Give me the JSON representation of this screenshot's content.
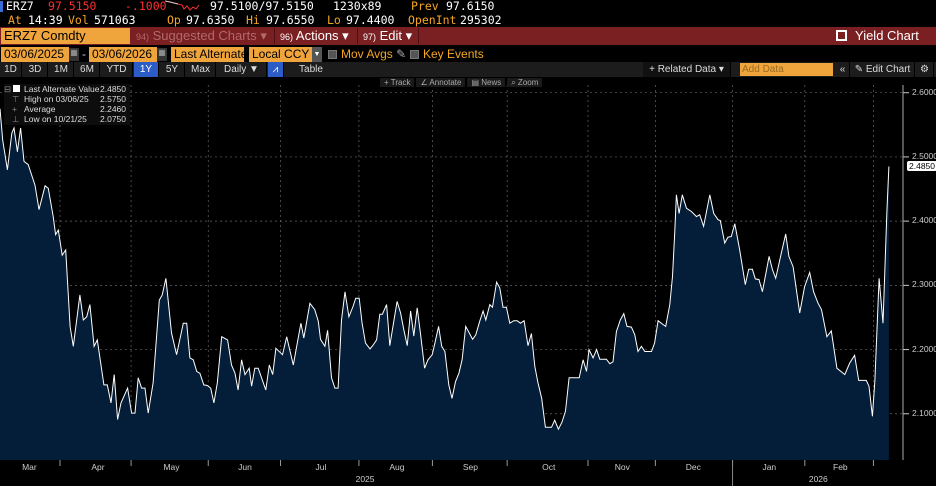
{
  "quote": {
    "ticker": "ERZ7",
    "last": "97.5150",
    "change": "-.1000",
    "bid_ask": "97.5100/97.5150",
    "size": "1230x89",
    "prev_label": "Prev",
    "prev": "97.6150",
    "at_label": "At",
    "time": "14:39",
    "vol_label": "Vol",
    "vol": "571063",
    "op_label": "Op",
    "op": "97.6350",
    "hi_label": "Hi",
    "hi": "97.6550",
    "lo_label": "Lo",
    "lo": "97.4400",
    "oi_label": "OpenInt",
    "oi": "295302"
  },
  "menubar": {
    "security": "ERZ7 Comdty",
    "suggested_num": "94)",
    "suggested": "Suggested Charts ▾",
    "actions_num": "96)",
    "actions": "Actions ▾",
    "edit_num": "97)",
    "edit": "Edit ▾",
    "yield_chart": "Yield Chart"
  },
  "controls": {
    "start_date": "03/06/2025",
    "end_date": "03/06/2026",
    "dash": "-",
    "field": "Last Alternate",
    "currency": "Local CCY",
    "mov_avgs": "Mov Avgs",
    "key_events": "Key Events"
  },
  "periods": [
    "1D",
    "3D",
    "1M",
    "6M",
    "YTD",
    "1Y",
    "5Y",
    "Max"
  ],
  "selected_period": "1Y",
  "frequency": "Daily ▼",
  "table_label": "Table",
  "right_toolbar": {
    "related": "+ Related Data ▾",
    "add_data_placeholder": "Add Data",
    "collapse": "«",
    "edit_chart": "✎ Edit Chart",
    "gear": "⚙"
  },
  "chart_tools": [
    "+ Track",
    "∠ Annotate",
    "▤ News",
    "⌕ Zoom"
  ],
  "legend": [
    {
      "label": "Last Alternate Value",
      "value": "2.4850"
    },
    {
      "label": "High on 03/06/25",
      "value": "2.5750"
    },
    {
      "label": "Average",
      "value": "2.2460"
    },
    {
      "label": "Low on 10/21/25",
      "value": "2.0750"
    }
  ],
  "colors": {
    "area": "#041d38",
    "line": "#ffffff",
    "accent": "#f0a53c",
    "menubar": "#7a1f22"
  },
  "chart_data": {
    "type": "area",
    "title": "ERZ7 Comdty Last Alternate Value",
    "x_unit": "days since 03/06/2025",
    "ylim": [
      2.028,
      2.612
    ],
    "y_ticks": [
      "2.6000",
      "2.5000",
      "2.4000",
      "2.3000",
      "2.2000",
      "2.1000"
    ],
    "y_tick_values": [
      2.6,
      2.5,
      2.4,
      2.3,
      2.2,
      2.1
    ],
    "last_value_label": "2.4850",
    "last_value": 2.485,
    "month_ticks": [
      {
        "label": "Mar",
        "mid": 12
      },
      {
        "label": "Apr",
        "mid": 40
      },
      {
        "label": "May",
        "mid": 70
      },
      {
        "label": "Jun",
        "mid": 100
      },
      {
        "label": "Jul",
        "mid": 131
      },
      {
        "label": "Aug",
        "mid": 162
      },
      {
        "label": "Sep",
        "mid": 192
      },
      {
        "label": "Oct",
        "mid": 224
      },
      {
        "label": "Nov",
        "mid": 254
      },
      {
        "label": "Dec",
        "mid": 283
      },
      {
        "label": "Jan",
        "mid": 314
      },
      {
        "label": "Feb",
        "mid": 343
      }
    ],
    "month_boundaries": [
      24.5,
      53.5,
      85,
      114.5,
      146.5,
      176.5,
      207,
      240,
      267.5,
      299,
      328.5,
      356.5
    ],
    "years": [
      {
        "label": "2025",
        "mid": 149
      },
      {
        "label": "2026",
        "mid": 334
      }
    ],
    "points": [
      [
        0,
        2.575
      ],
      [
        1.1,
        2.526
      ],
      [
        3,
        2.48
      ],
      [
        4.8,
        2.537
      ],
      [
        5.7,
        2.545
      ],
      [
        7.1,
        2.508
      ],
      [
        8.4,
        2.545
      ],
      [
        9.8,
        2.493
      ],
      [
        11.5,
        2.488
      ],
      [
        14.3,
        2.456
      ],
      [
        15.9,
        2.418
      ],
      [
        18.4,
        2.455
      ],
      [
        19.7,
        2.451
      ],
      [
        21.7,
        2.407
      ],
      [
        22.7,
        2.379
      ],
      [
        23.8,
        2.386
      ],
      [
        25.4,
        2.347
      ],
      [
        26.8,
        2.355
      ],
      [
        28.6,
        2.236
      ],
      [
        29.9,
        2.205
      ],
      [
        32.6,
        2.285
      ],
      [
        34,
        2.246
      ],
      [
        35.4,
        2.251
      ],
      [
        36.7,
        2.27
      ],
      [
        38.4,
        2.205
      ],
      [
        39.7,
        2.215
      ],
      [
        42.4,
        2.145
      ],
      [
        43.8,
        2.145
      ],
      [
        45.3,
        2.117
      ],
      [
        46.6,
        2.161
      ],
      [
        48,
        2.091
      ],
      [
        49.4,
        2.117
      ],
      [
        52.1,
        2.14
      ],
      [
        53.7,
        2.101
      ],
      [
        55.1,
        2.101
      ],
      [
        56.4,
        2.156
      ],
      [
        57.8,
        2.14
      ],
      [
        59.2,
        2.14
      ],
      [
        60.5,
        2.101
      ],
      [
        62.5,
        2.148
      ],
      [
        65,
        2.277
      ],
      [
        66.2,
        2.285
      ],
      [
        67.7,
        2.311
      ],
      [
        70,
        2.226
      ],
      [
        72.1,
        2.192
      ],
      [
        74.8,
        2.241
      ],
      [
        76.2,
        2.241
      ],
      [
        77.5,
        2.187
      ],
      [
        78.9,
        2.184
      ],
      [
        80.3,
        2.166
      ],
      [
        81.6,
        2.163
      ],
      [
        83.2,
        2.145
      ],
      [
        84.6,
        2.144
      ],
      [
        86,
        2.14
      ],
      [
        87.3,
        2.117
      ],
      [
        88.7,
        2.148
      ],
      [
        90.5,
        2.22
      ],
      [
        92.9,
        2.215
      ],
      [
        94.5,
        2.176
      ],
      [
        95.9,
        2.163
      ],
      [
        97.2,
        2.137
      ],
      [
        98.6,
        2.184
      ],
      [
        100,
        2.161
      ],
      [
        101.7,
        2.171
      ],
      [
        102.7,
        2.143
      ],
      [
        104,
        2.171
      ],
      [
        105.4,
        2.171
      ],
      [
        108.5,
        2.137
      ],
      [
        109.9,
        2.176
      ],
      [
        111.3,
        2.161
      ],
      [
        112.6,
        2.202
      ],
      [
        115.3,
        2.192
      ],
      [
        117,
        2.22
      ],
      [
        119.7,
        2.176
      ],
      [
        122.8,
        2.241
      ],
      [
        124,
        2.218
      ],
      [
        126.5,
        2.272
      ],
      [
        128.5,
        2.262
      ],
      [
        129.9,
        2.244
      ],
      [
        130.8,
        2.216
      ],
      [
        132.6,
        2.205
      ],
      [
        133.7,
        2.23
      ],
      [
        135.3,
        2.156
      ],
      [
        136.7,
        2.14
      ],
      [
        138,
        2.14
      ],
      [
        139.4,
        2.246
      ],
      [
        140.8,
        2.29
      ],
      [
        142.4,
        2.251
      ],
      [
        144.1,
        2.267
      ],
      [
        145.2,
        2.28
      ],
      [
        146.6,
        2.28
      ],
      [
        147.8,
        2.241
      ],
      [
        149.2,
        2.21
      ],
      [
        151,
        2.201
      ],
      [
        152.3,
        2.207
      ],
      [
        153.7,
        2.215
      ],
      [
        155,
        2.255
      ],
      [
        156.1,
        2.255
      ],
      [
        157.8,
        2.27
      ],
      [
        159.1,
        2.206
      ],
      [
        160.8,
        2.246
      ],
      [
        162.1,
        2.275
      ],
      [
        163.5,
        2.257
      ],
      [
        164.8,
        2.231
      ],
      [
        166.2,
        2.206
      ],
      [
        167.6,
        2.26
      ],
      [
        168.9,
        2.221
      ],
      [
        170.3,
        2.265
      ],
      [
        171.6,
        2.226
      ],
      [
        173.3,
        2.171
      ],
      [
        174.7,
        2.184
      ],
      [
        176.4,
        2.192
      ],
      [
        177.5,
        2.21
      ],
      [
        179,
        2.236
      ],
      [
        180.3,
        2.205
      ],
      [
        181.6,
        2.197
      ],
      [
        183.2,
        2.145
      ],
      [
        184.5,
        2.124
      ],
      [
        185.9,
        2.15
      ],
      [
        187.3,
        2.163
      ],
      [
        188.6,
        2.184
      ],
      [
        190.1,
        2.236
      ],
      [
        191.5,
        2.226
      ],
      [
        192.9,
        2.216
      ],
      [
        194.2,
        2.223
      ],
      [
        195.8,
        2.244
      ],
      [
        197.2,
        2.26
      ],
      [
        198.3,
        2.246
      ],
      [
        199.9,
        2.27
      ],
      [
        201,
        2.266
      ],
      [
        202.7,
        2.305
      ],
      [
        204,
        2.296
      ],
      [
        205.3,
        2.266
      ],
      [
        206.7,
        2.266
      ],
      [
        208.1,
        2.241
      ],
      [
        209.7,
        2.245
      ],
      [
        211.1,
        2.245
      ],
      [
        212.4,
        2.241
      ],
      [
        213.9,
        2.245
      ],
      [
        215.5,
        2.206
      ],
      [
        216.9,
        2.225
      ],
      [
        218.3,
        2.174
      ],
      [
        219.6,
        2.148
      ],
      [
        221.1,
        2.124
      ],
      [
        222.6,
        2.079
      ],
      [
        225.1,
        2.079
      ],
      [
        226.4,
        2.09
      ],
      [
        227.9,
        2.076
      ],
      [
        229.4,
        2.087
      ],
      [
        230.8,
        2.104
      ],
      [
        232.3,
        2.156
      ],
      [
        236.4,
        2.156
      ],
      [
        238,
        2.184
      ],
      [
        239.4,
        2.166
      ],
      [
        240.4,
        2.2
      ],
      [
        242.1,
        2.187
      ],
      [
        243.5,
        2.2
      ],
      [
        244.8,
        2.185
      ],
      [
        247.5,
        2.185
      ],
      [
        248.9,
        2.178
      ],
      [
        250.2,
        2.181
      ],
      [
        251.6,
        2.228
      ],
      [
        253.2,
        2.246
      ],
      [
        254.6,
        2.256
      ],
      [
        255.9,
        2.236
      ],
      [
        257.7,
        2.235
      ],
      [
        259.1,
        2.223
      ],
      [
        260.4,
        2.197
      ],
      [
        261.8,
        2.205
      ],
      [
        263.2,
        2.197
      ],
      [
        265.9,
        2.197
      ],
      [
        267.2,
        2.21
      ],
      [
        268.6,
        2.245
      ],
      [
        270.6,
        2.239
      ],
      [
        271.7,
        2.236
      ],
      [
        273.4,
        2.27
      ],
      [
        274.5,
        2.314
      ],
      [
        275.4,
        2.381
      ],
      [
        276.1,
        2.441
      ],
      [
        277.2,
        2.412
      ],
      [
        278.5,
        2.441
      ],
      [
        280.2,
        2.42
      ],
      [
        282.2,
        2.415
      ],
      [
        284.3,
        2.407
      ],
      [
        285.6,
        2.41
      ],
      [
        287.2,
        2.392
      ],
      [
        289.7,
        2.441
      ],
      [
        291.3,
        2.412
      ],
      [
        293.1,
        2.402
      ],
      [
        294,
        2.401
      ],
      [
        295.8,
        2.366
      ],
      [
        297.1,
        2.375
      ],
      [
        298.5,
        2.376
      ],
      [
        299.9,
        2.396
      ],
      [
        301.9,
        2.355
      ],
      [
        304.2,
        2.301
      ],
      [
        305.6,
        2.325
      ],
      [
        307.1,
        2.325
      ],
      [
        308.3,
        2.31
      ],
      [
        309.8,
        2.309
      ],
      [
        311.2,
        2.29
      ],
      [
        313.9,
        2.345
      ],
      [
        315.3,
        2.324
      ],
      [
        316.6,
        2.311
      ],
      [
        318.9,
        2.35
      ],
      [
        320.7,
        2.38
      ],
      [
        322,
        2.345
      ],
      [
        323.7,
        2.329
      ],
      [
        326.4,
        2.257
      ],
      [
        328.4,
        2.298
      ],
      [
        330.5,
        2.32
      ],
      [
        332.1,
        2.29
      ],
      [
        333.9,
        2.272
      ],
      [
        335.3,
        2.262
      ],
      [
        337.5,
        2.22
      ],
      [
        339.3,
        2.229
      ],
      [
        341.6,
        2.171
      ],
      [
        344.8,
        2.161
      ],
      [
        346.8,
        2.179
      ],
      [
        348.8,
        2.191
      ],
      [
        350.5,
        2.152
      ],
      [
        353.6,
        2.152
      ],
      [
        354.7,
        2.143
      ],
      [
        356.1,
        2.096
      ],
      [
        357.1,
        2.152
      ],
      [
        358.8,
        2.311
      ],
      [
        360.4,
        2.241
      ],
      [
        362,
        2.415
      ],
      [
        362.8,
        2.485
      ]
    ]
  }
}
